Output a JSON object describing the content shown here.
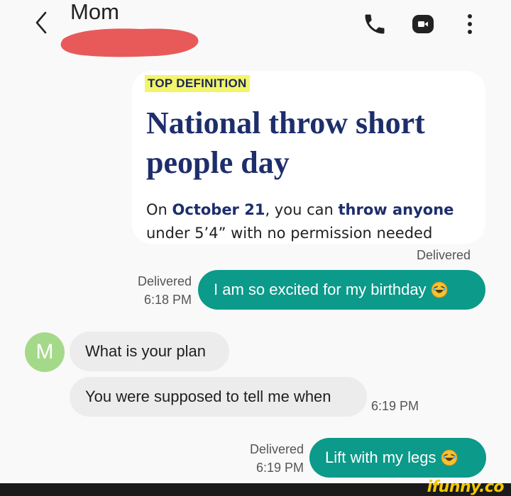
{
  "header": {
    "contact_name": "Mom",
    "icons": [
      "back-icon",
      "call-icon",
      "video-call-icon",
      "more-options-icon"
    ]
  },
  "image_card": {
    "badge": "TOP DEFINITION",
    "word": "National throw short people day",
    "definition_parts": {
      "p1": "On ",
      "b1": "October 21",
      "p2": ", you can ",
      "b2": "throw anyone",
      "p3": " under 5’4” with no permission needed"
    },
    "status": "Delivered"
  },
  "messages": [
    {
      "side": "sent",
      "text": "I am so excited for my birthday",
      "emoji": "rolling-laughing-emoji",
      "status": "Delivered",
      "time": "6:18 PM"
    },
    {
      "side": "received",
      "text": "What is your plan"
    },
    {
      "side": "received",
      "text": "You were supposed to tell me when",
      "time": "6:19 PM"
    },
    {
      "side": "sent",
      "text": "Lift with my legs",
      "emoji": "rolling-laughing-emoji",
      "status": "Delivered",
      "time": "6:19 PM"
    }
  ],
  "avatar_letter": "M",
  "colors": {
    "sent_bubble": "#0c9a8a",
    "received_bubble": "#ececec",
    "avatar": "#a5d98a",
    "redaction": "#e85a5a"
  },
  "watermark": "ifunny.co"
}
